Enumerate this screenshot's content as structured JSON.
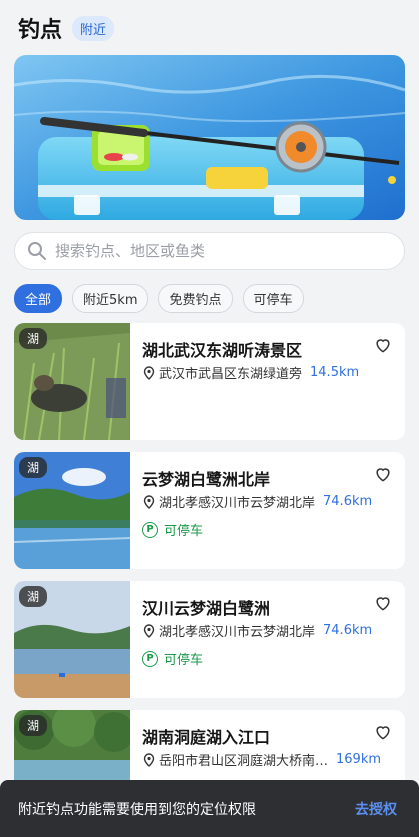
{
  "header": {
    "title": "钓点",
    "tag": "附近"
  },
  "search": {
    "placeholder": "搜索钓点、地区或鱼类"
  },
  "chips": [
    "全部",
    "附近5km",
    "免费钓点",
    "可停车"
  ],
  "spots": [
    {
      "badge": "湖",
      "title": "湖北武汉东湖听涛景区",
      "address": "武汉市武昌区东湖绿道旁",
      "distance": "14.5km",
      "parking": ""
    },
    {
      "badge": "湖",
      "title": "云梦湖白鹭洲北岸",
      "address": "湖北孝感汉川市云梦湖北岸",
      "distance": "74.6km",
      "parking": "可停车"
    },
    {
      "badge": "湖",
      "title": "汉川云梦湖白鹭洲",
      "address": "湖北孝感汉川市云梦湖北岸",
      "distance": "74.6km",
      "parking": "可停车"
    },
    {
      "badge": "湖",
      "title": "湖南洞庭湖入江口",
      "address": "岳阳市君山区洞庭湖大桥南…",
      "distance": "169km",
      "parking": ""
    }
  ],
  "parking_icon": "P",
  "toast": {
    "message": "附近钓点功能需要使用到您的定位权限",
    "action": "去授权"
  },
  "colors": {
    "accent": "#2f6fe0",
    "parking": "#1a9a4a"
  }
}
